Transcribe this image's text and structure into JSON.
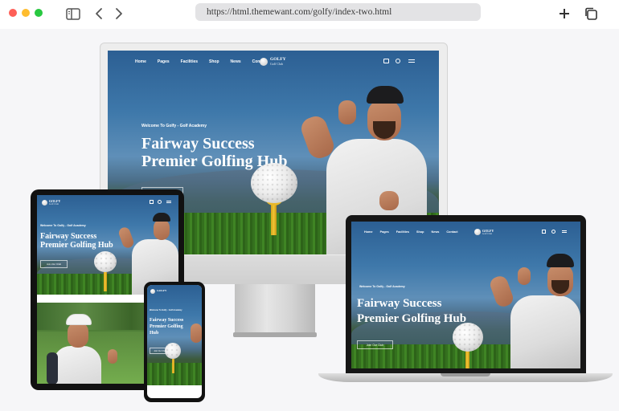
{
  "browser": {
    "url": "https://html.themewant.com/golfy/index-two.html",
    "icons": [
      "sidebar-icon",
      "back-arrow-icon",
      "forward-arrow-icon",
      "plus-icon",
      "tabs-icon"
    ]
  },
  "site": {
    "nav_items": [
      "Home",
      "Pages",
      "Facilities",
      "Shop",
      "News",
      "Contact"
    ],
    "logo_name": "GOLFY",
    "logo_tagline": "Golf Club",
    "welcome": "Welcome To Golfy - Golf Academy",
    "title_line1": "Fairway Success",
    "title_line2": "Premier Golfing Hub",
    "cta": "Join Our Club",
    "phone_title": [
      "Fairway Success",
      "Premier Golfing",
      "Hub"
    ]
  },
  "colors": {
    "accent_red": "#fe5f57",
    "accent_yellow": "#febc2e",
    "accent_green": "#28c840",
    "hero_blue": "#2c5f93",
    "grass_green": "#3f8424"
  }
}
